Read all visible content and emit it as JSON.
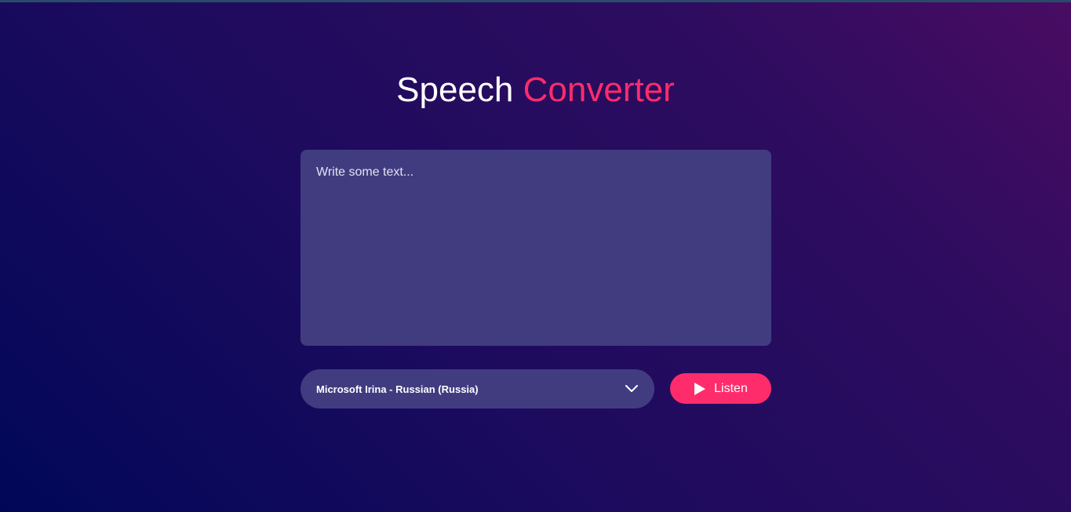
{
  "header": {
    "title_part1": "Speech",
    "title_part2": "Converter"
  },
  "editor": {
    "placeholder": "Write some text...",
    "value": ""
  },
  "voice_select": {
    "selected": "Microsoft Irina - Russian (Russia)",
    "icon": "chevron-down-icon"
  },
  "listen_button": {
    "label": "Listen",
    "icon": "play-icon"
  },
  "colors": {
    "accent": "#ff2c6b",
    "panel": "#413c80",
    "background_start": "#010758",
    "background_end": "#490c63"
  }
}
